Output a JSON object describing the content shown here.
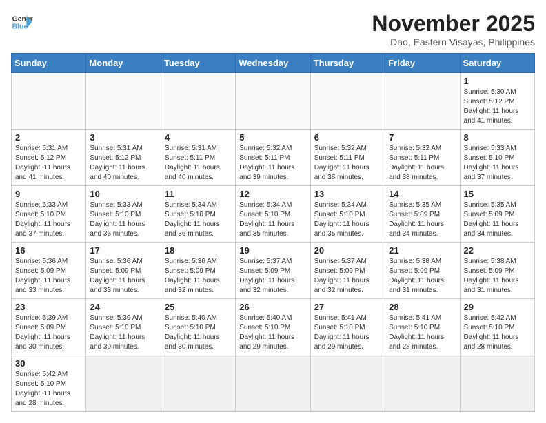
{
  "header": {
    "logo_general": "General",
    "logo_blue": "Blue",
    "month_title": "November 2025",
    "location": "Dao, Eastern Visayas, Philippines"
  },
  "weekdays": [
    "Sunday",
    "Monday",
    "Tuesday",
    "Wednesday",
    "Thursday",
    "Friday",
    "Saturday"
  ],
  "weeks": [
    [
      {
        "day": "",
        "info": ""
      },
      {
        "day": "",
        "info": ""
      },
      {
        "day": "",
        "info": ""
      },
      {
        "day": "",
        "info": ""
      },
      {
        "day": "",
        "info": ""
      },
      {
        "day": "",
        "info": ""
      },
      {
        "day": "1",
        "info": "Sunrise: 5:30 AM\nSunset: 5:12 PM\nDaylight: 11 hours and 41 minutes."
      }
    ],
    [
      {
        "day": "2",
        "info": "Sunrise: 5:31 AM\nSunset: 5:12 PM\nDaylight: 11 hours and 41 minutes."
      },
      {
        "day": "3",
        "info": "Sunrise: 5:31 AM\nSunset: 5:12 PM\nDaylight: 11 hours and 40 minutes."
      },
      {
        "day": "4",
        "info": "Sunrise: 5:31 AM\nSunset: 5:11 PM\nDaylight: 11 hours and 40 minutes."
      },
      {
        "day": "5",
        "info": "Sunrise: 5:32 AM\nSunset: 5:11 PM\nDaylight: 11 hours and 39 minutes."
      },
      {
        "day": "6",
        "info": "Sunrise: 5:32 AM\nSunset: 5:11 PM\nDaylight: 11 hours and 38 minutes."
      },
      {
        "day": "7",
        "info": "Sunrise: 5:32 AM\nSunset: 5:11 PM\nDaylight: 11 hours and 38 minutes."
      },
      {
        "day": "8",
        "info": "Sunrise: 5:33 AM\nSunset: 5:10 PM\nDaylight: 11 hours and 37 minutes."
      }
    ],
    [
      {
        "day": "9",
        "info": "Sunrise: 5:33 AM\nSunset: 5:10 PM\nDaylight: 11 hours and 37 minutes."
      },
      {
        "day": "10",
        "info": "Sunrise: 5:33 AM\nSunset: 5:10 PM\nDaylight: 11 hours and 36 minutes."
      },
      {
        "day": "11",
        "info": "Sunrise: 5:34 AM\nSunset: 5:10 PM\nDaylight: 11 hours and 36 minutes."
      },
      {
        "day": "12",
        "info": "Sunrise: 5:34 AM\nSunset: 5:10 PM\nDaylight: 11 hours and 35 minutes."
      },
      {
        "day": "13",
        "info": "Sunrise: 5:34 AM\nSunset: 5:10 PM\nDaylight: 11 hours and 35 minutes."
      },
      {
        "day": "14",
        "info": "Sunrise: 5:35 AM\nSunset: 5:09 PM\nDaylight: 11 hours and 34 minutes."
      },
      {
        "day": "15",
        "info": "Sunrise: 5:35 AM\nSunset: 5:09 PM\nDaylight: 11 hours and 34 minutes."
      }
    ],
    [
      {
        "day": "16",
        "info": "Sunrise: 5:36 AM\nSunset: 5:09 PM\nDaylight: 11 hours and 33 minutes."
      },
      {
        "day": "17",
        "info": "Sunrise: 5:36 AM\nSunset: 5:09 PM\nDaylight: 11 hours and 33 minutes."
      },
      {
        "day": "18",
        "info": "Sunrise: 5:36 AM\nSunset: 5:09 PM\nDaylight: 11 hours and 32 minutes."
      },
      {
        "day": "19",
        "info": "Sunrise: 5:37 AM\nSunset: 5:09 PM\nDaylight: 11 hours and 32 minutes."
      },
      {
        "day": "20",
        "info": "Sunrise: 5:37 AM\nSunset: 5:09 PM\nDaylight: 11 hours and 32 minutes."
      },
      {
        "day": "21",
        "info": "Sunrise: 5:38 AM\nSunset: 5:09 PM\nDaylight: 11 hours and 31 minutes."
      },
      {
        "day": "22",
        "info": "Sunrise: 5:38 AM\nSunset: 5:09 PM\nDaylight: 11 hours and 31 minutes."
      }
    ],
    [
      {
        "day": "23",
        "info": "Sunrise: 5:39 AM\nSunset: 5:09 PM\nDaylight: 11 hours and 30 minutes."
      },
      {
        "day": "24",
        "info": "Sunrise: 5:39 AM\nSunset: 5:10 PM\nDaylight: 11 hours and 30 minutes."
      },
      {
        "day": "25",
        "info": "Sunrise: 5:40 AM\nSunset: 5:10 PM\nDaylight: 11 hours and 30 minutes."
      },
      {
        "day": "26",
        "info": "Sunrise: 5:40 AM\nSunset: 5:10 PM\nDaylight: 11 hours and 29 minutes."
      },
      {
        "day": "27",
        "info": "Sunrise: 5:41 AM\nSunset: 5:10 PM\nDaylight: 11 hours and 29 minutes."
      },
      {
        "day": "28",
        "info": "Sunrise: 5:41 AM\nSunset: 5:10 PM\nDaylight: 11 hours and 28 minutes."
      },
      {
        "day": "29",
        "info": "Sunrise: 5:42 AM\nSunset: 5:10 PM\nDaylight: 11 hours and 28 minutes."
      }
    ],
    [
      {
        "day": "30",
        "info": "Sunrise: 5:42 AM\nSunset: 5:10 PM\nDaylight: 11 hours and 28 minutes."
      },
      {
        "day": "",
        "info": ""
      },
      {
        "day": "",
        "info": ""
      },
      {
        "day": "",
        "info": ""
      },
      {
        "day": "",
        "info": ""
      },
      {
        "day": "",
        "info": ""
      },
      {
        "day": "",
        "info": ""
      }
    ]
  ]
}
